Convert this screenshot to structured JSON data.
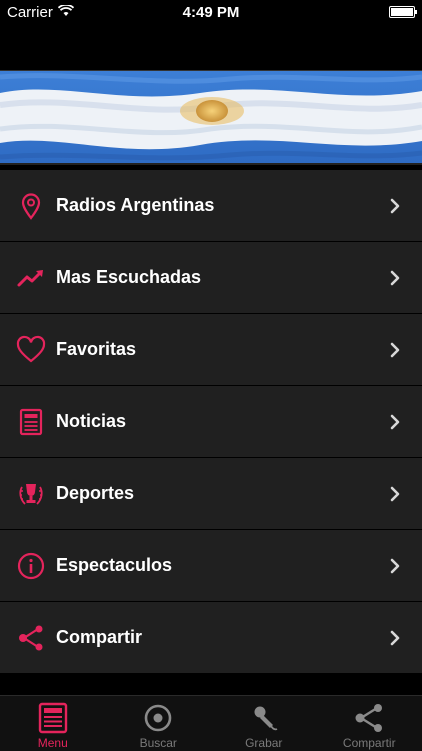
{
  "status": {
    "carrier": "Carrier",
    "time": "4:49 PM",
    "battery_level": 1.0
  },
  "accent": "#e4245c",
  "menu": {
    "items": [
      {
        "label": "Radios Argentinas",
        "icon": "location-pin-icon"
      },
      {
        "label": "Mas Escuchadas",
        "icon": "trending-up-icon"
      },
      {
        "label": "Favoritas",
        "icon": "heart-icon"
      },
      {
        "label": "Noticias",
        "icon": "newspaper-icon"
      },
      {
        "label": "Deportes",
        "icon": "trophy-icon"
      },
      {
        "label": "Espectaculos",
        "icon": "info-icon"
      },
      {
        "label": "Compartir",
        "icon": "share-icon"
      }
    ]
  },
  "tabs": [
    {
      "label": "Menu",
      "icon": "menu-list-icon",
      "active": true
    },
    {
      "label": "Buscar",
      "icon": "target-icon",
      "active": false
    },
    {
      "label": "Grabar",
      "icon": "microphone-icon",
      "active": false
    },
    {
      "label": "Compartir",
      "icon": "share-icon",
      "active": false
    }
  ]
}
